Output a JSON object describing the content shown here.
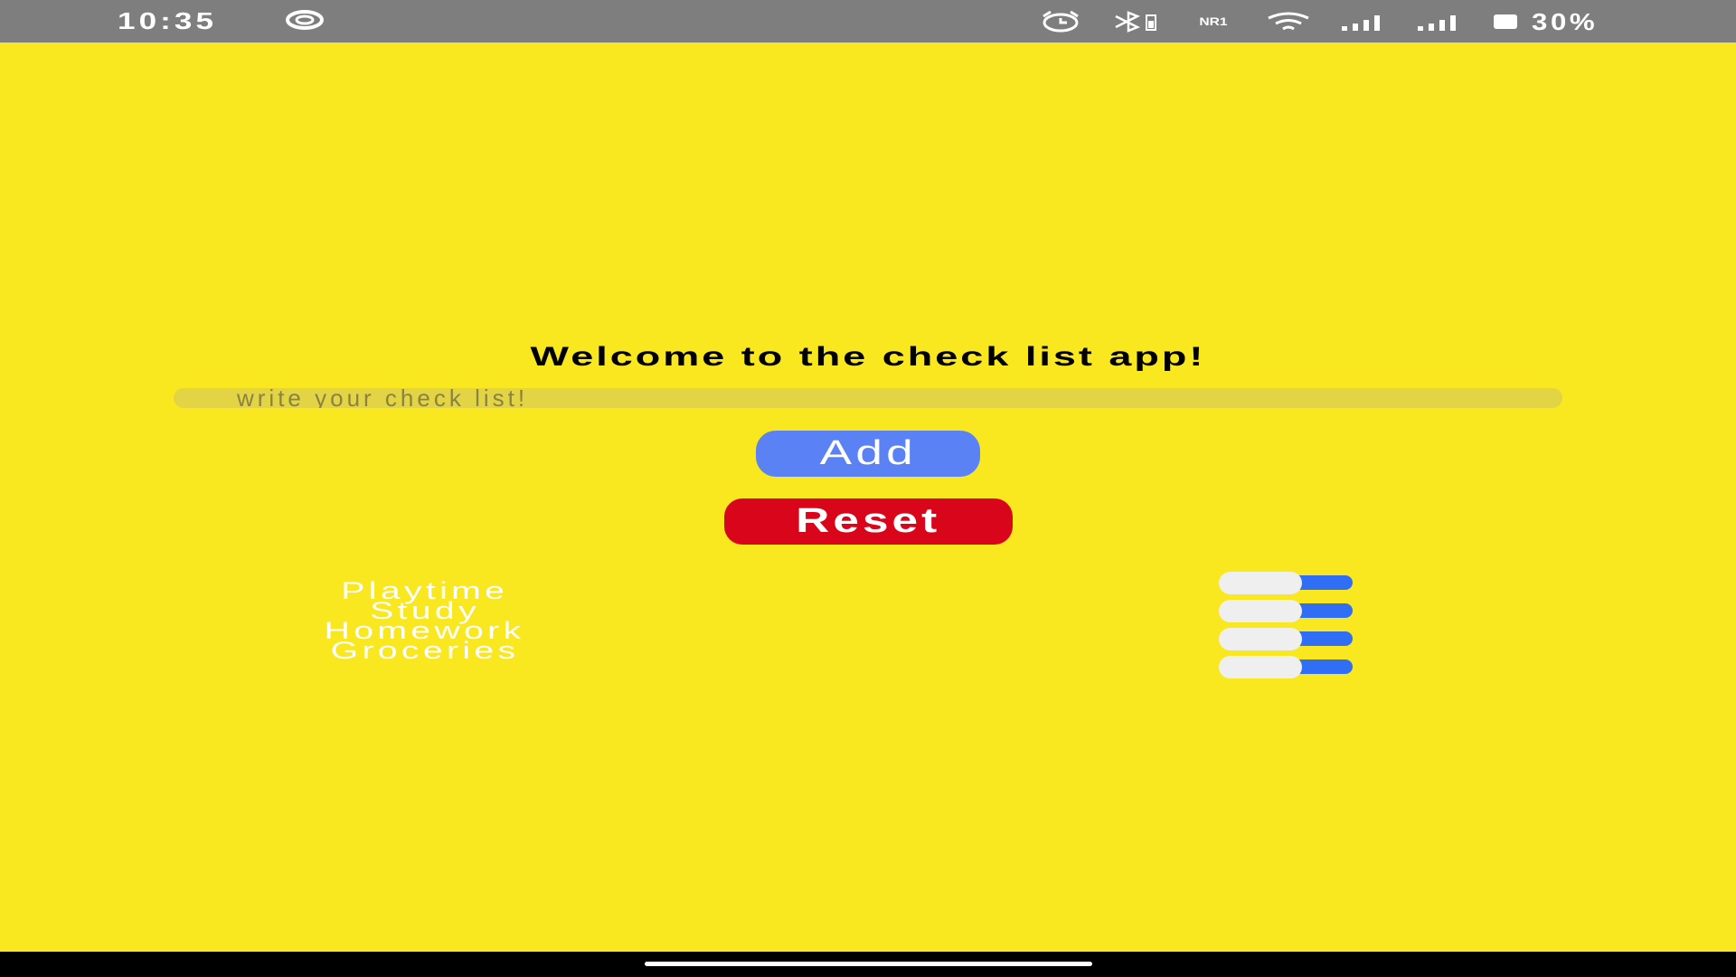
{
  "status_bar": {
    "time": "10:35",
    "left_icon": "data-sync-icon",
    "right_icons": [
      "alarm-icon",
      "bluetooth-battery-icon",
      "nr-network-icon",
      "wifi-icon",
      "signal-icon",
      "signal-icon",
      "battery-icon"
    ],
    "network_label": "NR1",
    "battery_percent": "30%"
  },
  "main": {
    "title": "Welcome to the check list app!",
    "input": {
      "placeholder": "write your check list!",
      "value": ""
    },
    "add_label": "Add",
    "reset_label": "Reset",
    "tasks": [
      {
        "label": "Playtime",
        "enabled": true
      },
      {
        "label": "Study",
        "enabled": true
      },
      {
        "label": "Homework",
        "enabled": true
      },
      {
        "label": "Groceries",
        "enabled": true
      }
    ]
  },
  "colors": {
    "background": "#f9e71f",
    "add_button": "#5b82f5",
    "reset_button": "#d9061b",
    "toggle_track": "#2f6ef5"
  }
}
